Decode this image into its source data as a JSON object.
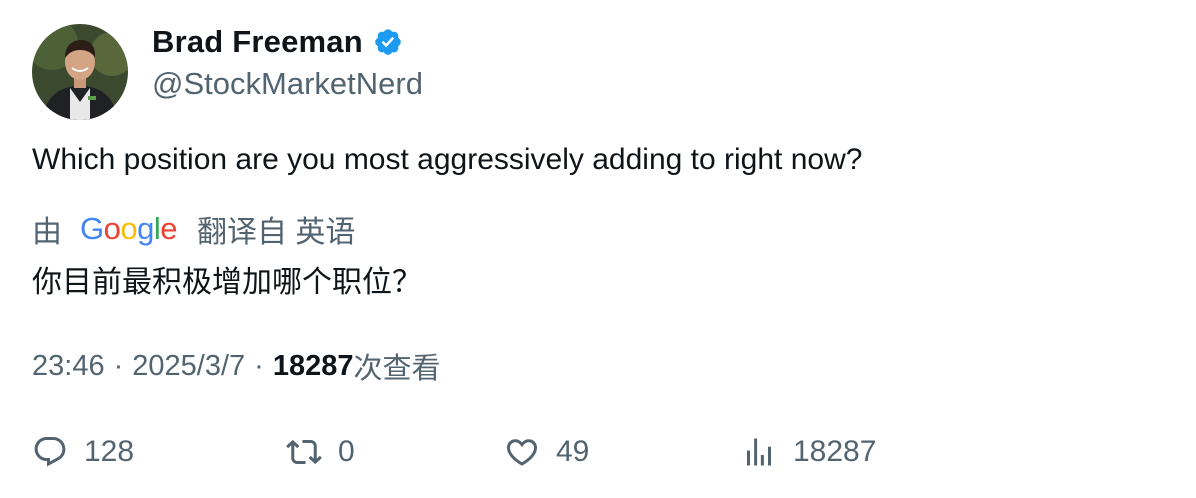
{
  "author": {
    "display_name": "Brad Freeman",
    "handle": "@StockMarketNerd",
    "verified_icon": "verified-badge-icon",
    "verified_color": "#1d9bf0"
  },
  "tweet": {
    "text": "Which position are you most aggressively adding to right now?"
  },
  "translation": {
    "prefix": "由",
    "provider_logo": "Google",
    "suffix": "翻译自 英语",
    "translated_text": "你目前最积极增加哪个职位？"
  },
  "meta": {
    "time": "23:46",
    "separator": "·",
    "date": "2025/3/7",
    "views": "18287",
    "views_suffix": "次查看"
  },
  "actions": {
    "replies": "128",
    "retweets": "0",
    "likes": "49",
    "views": "18287"
  },
  "colors": {
    "text_primary": "#0f1419",
    "text_secondary": "#536471",
    "google_blue": "#4285F4",
    "google_red": "#EA4335",
    "google_yellow": "#FBBC05",
    "google_green": "#34A853"
  }
}
